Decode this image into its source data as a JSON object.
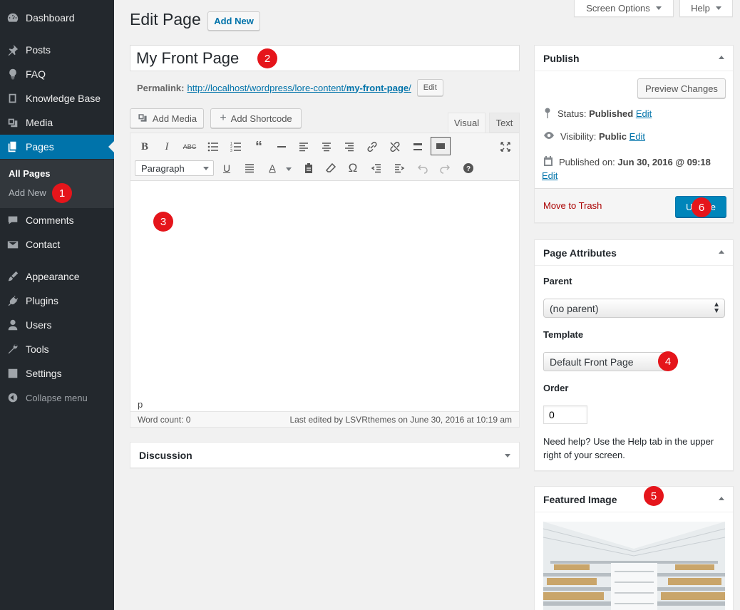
{
  "sidebar": {
    "items": [
      {
        "label": "Dashboard",
        "icon": "dashboard-icon"
      },
      {
        "label": "Posts",
        "icon": "pin-icon"
      },
      {
        "label": "FAQ",
        "icon": "lightbulb-icon"
      },
      {
        "label": "Knowledge Base",
        "icon": "book-icon"
      },
      {
        "label": "Media",
        "icon": "media-icon"
      },
      {
        "label": "Pages",
        "icon": "pages-icon",
        "active": true
      },
      {
        "label": "Comments",
        "icon": "comment-icon"
      },
      {
        "label": "Contact",
        "icon": "mail-icon"
      },
      {
        "label": "Appearance",
        "icon": "brush-icon"
      },
      {
        "label": "Plugins",
        "icon": "plug-icon"
      },
      {
        "label": "Users",
        "icon": "user-icon"
      },
      {
        "label": "Tools",
        "icon": "wrench-icon"
      },
      {
        "label": "Settings",
        "icon": "settings-icon"
      }
    ],
    "submenu": {
      "all_pages": "All Pages",
      "add_new": "Add New"
    },
    "collapse": "Collapse menu"
  },
  "screen_options": "Screen Options",
  "help": "Help",
  "heading": "Edit Page",
  "add_new": "Add New",
  "title_value": "My Front Page",
  "permalink": {
    "label": "Permalink:",
    "url_prefix": "http://localhost/wordpress/lore-content/",
    "slug": "my-front-page",
    "url_suffix": "/",
    "edit": "Edit"
  },
  "media_buttons": {
    "add_media": "Add Media",
    "add_shortcode": "Add Shortcode"
  },
  "editor_tabs": {
    "visual": "Visual",
    "text": "Text"
  },
  "format_select": "Paragraph",
  "status_path": "p",
  "word_count": "Word count: 0",
  "last_edited": "Last edited by LSVRthemes on June 30, 2016 at 10:19 am",
  "discussion": "Discussion",
  "publish": {
    "title": "Publish",
    "preview": "Preview Changes",
    "status_label": "Status:",
    "status_value": "Published",
    "visibility_label": "Visibility:",
    "visibility_value": "Public",
    "published_label": "Published on:",
    "published_value": "Jun 30, 2016 @ 09:18",
    "edit": "Edit",
    "trash": "Move to Trash",
    "update": "Update"
  },
  "page_attributes": {
    "title": "Page Attributes",
    "parent_label": "Parent",
    "parent_value": "(no parent)",
    "template_label": "Template",
    "template_value": "Default Front Page",
    "order_label": "Order",
    "order_value": "0",
    "help": "Need help? Use the Help tab in the upper right of your screen."
  },
  "featured_image": {
    "title": "Featured Image"
  },
  "badges": [
    "1",
    "2",
    "3",
    "4",
    "5",
    "6"
  ],
  "colors": {
    "sidebar": "#23282d",
    "active": "#0073aa",
    "badge": "#e5151b",
    "link": "#0073aa",
    "trash": "#a00"
  }
}
